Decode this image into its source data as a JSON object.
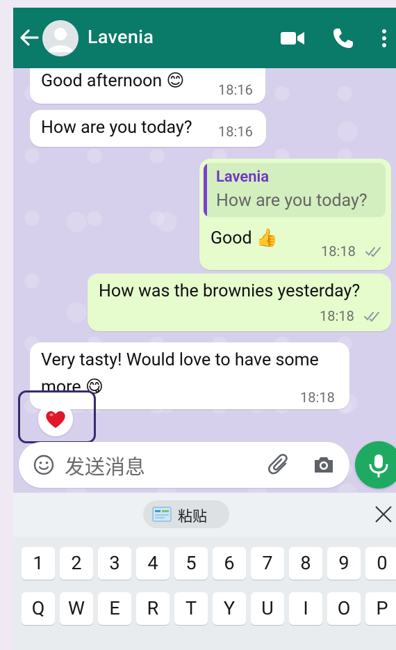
{
  "header": {
    "contact_name": "Lavenia",
    "bg_color": "#0a7a69"
  },
  "messages": [
    {
      "direction": "in",
      "text": "Good afternoon 😊",
      "time": "18:16"
    },
    {
      "direction": "in",
      "text": "How are you today?",
      "time": "18:16"
    },
    {
      "direction": "out",
      "quote_name": "Lavenia",
      "quote_text": "How are you today?",
      "text": "Good 👍",
      "time": "18:18"
    },
    {
      "direction": "out",
      "text": "How was the brownies yesterday?",
      "time": "18:18"
    },
    {
      "direction": "in",
      "text_line1": "Very tasty! Would love to have some",
      "text_line2": "more 😋",
      "time": "18:18"
    }
  ],
  "reaction": "❤️",
  "composer": {
    "placeholder": "发送消息"
  },
  "keyboard": {
    "paste_label": "粘贴",
    "number_row": [
      "1",
      "2",
      "3",
      "4",
      "5",
      "6",
      "7",
      "8",
      "9",
      "0"
    ],
    "letter_row": [
      "Q",
      "W",
      "E",
      "R",
      "T",
      "Y",
      "U",
      "I",
      "O",
      "P"
    ]
  },
  "icons": [
    "back-arrow-icon",
    "avatar-icon",
    "video-call-icon",
    "phone-icon",
    "more-vert-icon",
    "emoji-icon",
    "attach-icon",
    "camera-icon",
    "mic-icon",
    "clipboard-icon",
    "close-icon",
    "double-check-icon"
  ],
  "colors": {
    "chat_bg": "#d7d0ec",
    "incoming": "#ffffff",
    "outgoing": "#e6fccd",
    "mic": "#1faa62",
    "quote_accent": "#7b3fd0"
  }
}
